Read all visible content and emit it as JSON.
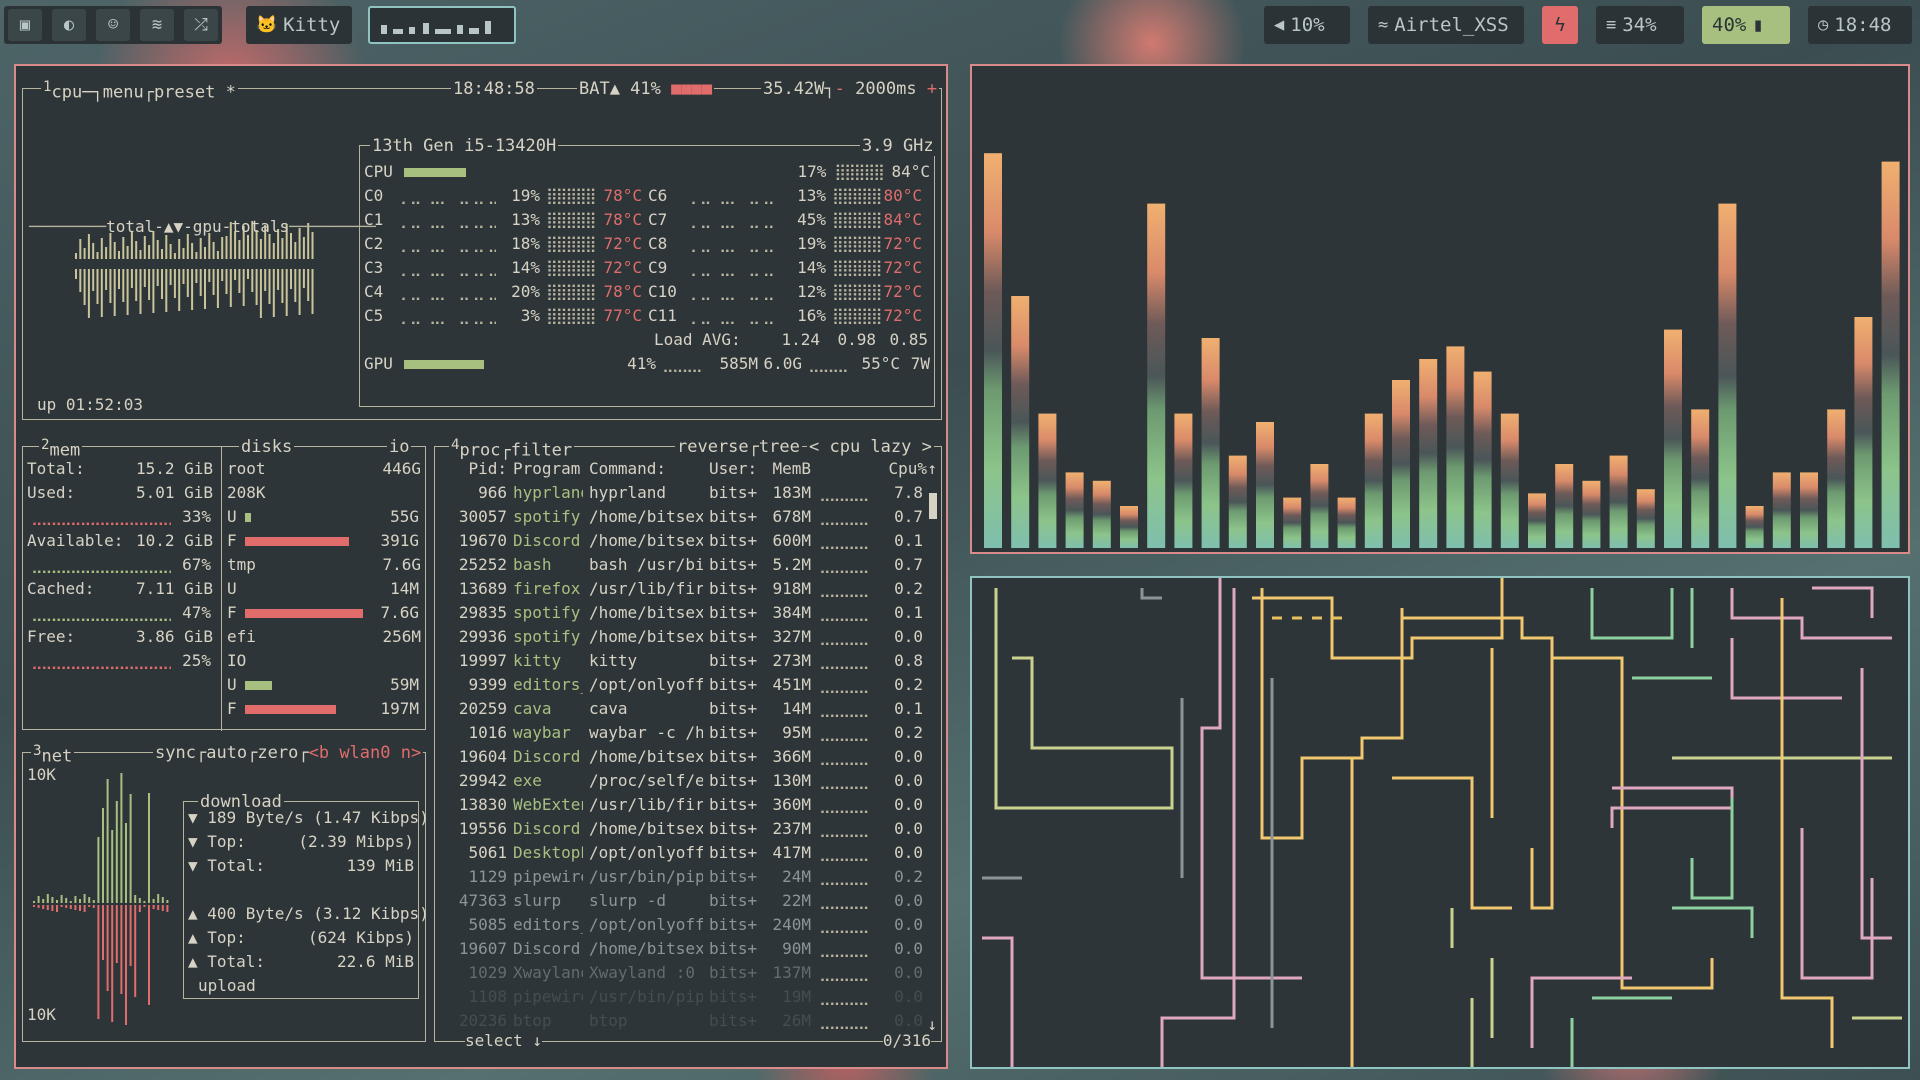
{
  "taskbar": {
    "left": [
      {
        "icon": "terminal-icon",
        "glyph": "▣"
      },
      {
        "icon": "browser-icon",
        "glyph": "◐"
      },
      {
        "icon": "discord-icon",
        "glyph": "☺"
      },
      {
        "icon": "spotify-icon",
        "glyph": "≋"
      },
      {
        "icon": "shuffle-icon",
        "glyph": "⤮"
      }
    ],
    "app": {
      "glyph": "🐱",
      "label": "Kitty"
    },
    "volume": "10%",
    "wifi": "Airtel_XSS",
    "cpu": "34%",
    "battery": "40%",
    "clock": "18:48"
  },
  "cpu": {
    "header": {
      "num": "1",
      "title": "cpu",
      "menu": "menu",
      "preset": "preset *",
      "time": "18:48:58",
      "bat": "BAT▲ 41%",
      "power": "35.42W",
      "interval": "2000ms",
      "minus": "-",
      "plus": "+"
    },
    "graph_label": "total-▲▼-gpu-totals",
    "uptime": "up 01:52:03",
    "model": "13th Gen i5-13420H",
    "freq": "3.9 GHz",
    "total": {
      "label": "CPU",
      "pct": "17%",
      "temp": "84°C"
    },
    "cores_left": [
      {
        "n": "C0",
        "p": "19%",
        "t": "78°C"
      },
      {
        "n": "C1",
        "p": "13%",
        "t": "78°C"
      },
      {
        "n": "C2",
        "p": "18%",
        "t": "72°C"
      },
      {
        "n": "C3",
        "p": "14%",
        "t": "72°C"
      },
      {
        "n": "C4",
        "p": "20%",
        "t": "78°C"
      },
      {
        "n": "C5",
        "p": "3%",
        "t": "77°C"
      }
    ],
    "cores_right": [
      {
        "n": "C6",
        "p": "13%",
        "t": "80°C"
      },
      {
        "n": "C7",
        "p": "45%",
        "t": "84°C"
      },
      {
        "n": "C8",
        "p": "19%",
        "t": "72°C"
      },
      {
        "n": "C9",
        "p": "14%",
        "t": "72°C"
      },
      {
        "n": "C10",
        "p": "12%",
        "t": "72°C"
      },
      {
        "n": "C11",
        "p": "16%",
        "t": "72°C"
      }
    ],
    "load": {
      "label": "Load AVG:",
      "v1": "1.24",
      "v2": "0.98",
      "v3": "0.85"
    },
    "gpu": {
      "label": "GPU",
      "pct": "41%",
      "mem": "585M",
      "total": "6.0G",
      "temp": "55°C",
      "power": "7W"
    }
  },
  "mem": {
    "num": "2",
    "title": "mem",
    "total": "Total:",
    "total_v": "15.2 GiB",
    "used": "Used:",
    "used_v": "5.01 GiB",
    "used_p": "33%",
    "avail": "Available:",
    "avail_v": "10.2 GiB",
    "avail_p": "67%",
    "cached": "Cached:",
    "cached_v": "7.11 GiB",
    "cached_p": "47%",
    "free": "Free:",
    "free_v": "3.86 GiB",
    "free_p": "25%"
  },
  "disks": {
    "title": "disks",
    "io": "io",
    "root": "root",
    "root_size": "446G",
    "io_val": "208K",
    "root_u": "U",
    "root_u_v": "55G",
    "root_f": "F",
    "root_f_v": "391G",
    "tmp": "tmp",
    "tmp_size": "7.6G",
    "tmp_u": "U",
    "tmp_u_v": "14M",
    "tmp_f": "F",
    "tmp_f_v": "7.6G",
    "efi": "efi",
    "efi_size": "256M",
    "efi_io": "IO",
    "efi_u": "U",
    "efi_u_v": "59M",
    "efi_f": "F",
    "efi_f_v": "197M"
  },
  "net": {
    "num": "3",
    "title": "net",
    "sync": "sync",
    "auto": "auto",
    "zero": "zero",
    "iface": "<b wlan0 n>",
    "top_scale": "10K",
    "bottom_scale": "10K",
    "download": "download",
    "d_rate": "▼ 189 Byte/s (1.47 Kibps)",
    "d_top": "▼ Top:",
    "d_top_v": "(2.39 Mibps)",
    "d_total": "▼ Total:",
    "d_total_v": "139 MiB",
    "u_rate": "▲ 400 Byte/s (3.12 Kibps)",
    "u_top": "▲ Top:",
    "u_top_v": "(624 Kibps)",
    "u_total": "▲ Total:",
    "u_total_v": "22.6 MiB",
    "upload": "upload"
  },
  "proc": {
    "num": "4",
    "title": "proc",
    "filter": "filter",
    "reverse": "reverse",
    "tree": "tree",
    "mode": "< cpu lazy >",
    "cols": [
      "Pid:",
      "Program:",
      "Command:",
      "User:",
      "MemB",
      "Cpu%"
    ],
    "rows": [
      [
        "966",
        "hyprland",
        "hyprland",
        "bits+",
        "183M",
        "7.8"
      ],
      [
        "30057",
        "spotify",
        "/home/bitsex",
        "bits+",
        "678M",
        "0.7"
      ],
      [
        "19670",
        "Discord",
        "/home/bitsex",
        "bits+",
        "600M",
        "0.1"
      ],
      [
        "25252",
        "bash",
        "bash /usr/bi",
        "bits+",
        "5.2M",
        "0.7"
      ],
      [
        "13689",
        "firefox",
        "/usr/lib/fir",
        "bits+",
        "918M",
        "0.2"
      ],
      [
        "29835",
        "spotify",
        "/home/bitsex",
        "bits+",
        "384M",
        "0.1"
      ],
      [
        "29936",
        "spotify",
        "/home/bitsex",
        "bits+",
        "327M",
        "0.0"
      ],
      [
        "19997",
        "kitty",
        "kitty",
        "bits+",
        "273M",
        "0.8"
      ],
      [
        "9399",
        "editors_",
        "/opt/onlyoff",
        "bits+",
        "451M",
        "0.2"
      ],
      [
        "20259",
        "cava",
        "cava",
        "bits+",
        "14M",
        "0.1"
      ],
      [
        "1016",
        "waybar",
        "waybar -c /h",
        "bits+",
        "95M",
        "0.2"
      ],
      [
        "19604",
        "Discord",
        "/home/bitsex",
        "bits+",
        "366M",
        "0.0"
      ],
      [
        "29942",
        "exe",
        "/proc/self/e",
        "bits+",
        "130M",
        "0.0"
      ],
      [
        "13830",
        "WebExten",
        "/usr/lib/fir",
        "bits+",
        "360M",
        "0.0"
      ],
      [
        "19556",
        "Discord",
        "/home/bitsex",
        "bits+",
        "237M",
        "0.0"
      ],
      [
        "5061",
        "DesktopE",
        "/opt/onlyoff",
        "bits+",
        "417M",
        "0.0"
      ],
      [
        "1129",
        "pipewire",
        "/usr/bin/pip",
        "bits+",
        "24M",
        "0.2"
      ],
      [
        "47363",
        "slurp",
        "slurp -d",
        "bits+",
        "22M",
        "0.0"
      ],
      [
        "5085",
        "editors_",
        "/opt/onlyoff",
        "bits+",
        "240M",
        "0.0"
      ],
      [
        "19607",
        "Discord",
        "/home/bitsex",
        "bits+",
        "90M",
        "0.0"
      ],
      [
        "1029",
        "Xwayland",
        "Xwayland :0",
        "bits+",
        "137M",
        "0.0"
      ],
      [
        "1108",
        "pipewire",
        "/usr/bin/pip",
        "bits+",
        "19M",
        "0.0"
      ],
      [
        "20236",
        "btop",
        "btop",
        "bits+",
        "26M",
        "0.0"
      ]
    ],
    "select": "select ↓",
    "count": "0/316"
  },
  "cava": {
    "levels": [
      0.94,
      0.6,
      0.32,
      0.18,
      0.16,
      0.1,
      0.82,
      0.32,
      0.5,
      0.22,
      0.3,
      0.12,
      0.2,
      0.12,
      0.32,
      0.4,
      0.45,
      0.48,
      0.42,
      0.32,
      0.13,
      0.2,
      0.16,
      0.22,
      0.14,
      0.52,
      0.33,
      0.82,
      0.1,
      0.18,
      0.18,
      0.33,
      0.55,
      0.92
    ]
  },
  "colors": {
    "accent": "#d98a8a",
    "teal": "#8fc4c0",
    "green": "#a7c080",
    "red": "#e06c6c"
  }
}
